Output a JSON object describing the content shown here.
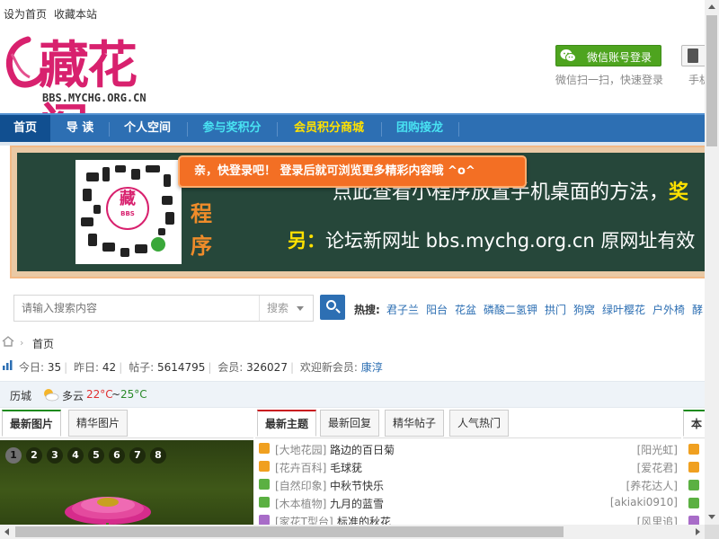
{
  "topbar": {
    "set_home": "设为首页",
    "bookmark": "收藏本站"
  },
  "logo": {
    "text": "藏花阁",
    "url": "BBS.MYCHG.ORG.CN"
  },
  "login": {
    "wechat_button": "微信账号登录",
    "wechat_tip": "微信扫一扫，快速登录",
    "mobile_tip": "手机"
  },
  "nav": {
    "items": [
      "首页",
      "导 读",
      "个人空间",
      "参与奖积分",
      "会员积分商城",
      "团购接龙"
    ]
  },
  "banner": {
    "qr_label": "藏",
    "side_chars": [
      "程",
      "序"
    ],
    "line1_text": "点此查看小程序放置手机桌面的方法，",
    "line1_highlight": "奖",
    "line2_prefix": "另：",
    "line2_text": "论坛新网址 bbs.mychg.org.cn  原网址有效",
    "login_popup": "亲，快登录吧！ 登录后就可浏览更多精彩内容哦 ^o^"
  },
  "search": {
    "placeholder": "请输入搜索内容",
    "type": "搜索",
    "hot_label": "热搜:",
    "hot_words": [
      "君子兰",
      "阳台",
      "花盆",
      "磷酸二氢钾",
      "拱门",
      "狗窝",
      "绿叶樱花",
      "户外椅",
      "酵"
    ]
  },
  "breadcrumb": {
    "home": "首页"
  },
  "stats": {
    "today_label": "今日:",
    "today": "35",
    "yesterday_label": "昨日:",
    "yesterday": "42",
    "posts_label": "帖子:",
    "posts": "5614795",
    "members_label": "会员:",
    "members": "326027",
    "welcome_label": "欢迎新会员:",
    "newest": "康淳"
  },
  "weather": {
    "city": "历城",
    "condition": "多云",
    "high": "22°C",
    "tilde": "~",
    "low": "25°C"
  },
  "left_panel": {
    "tabs": [
      "最新图片",
      "精华图片"
    ],
    "pages": [
      "1",
      "2",
      "3",
      "4",
      "5",
      "6",
      "7",
      "8"
    ]
  },
  "mid_panel": {
    "tabs": [
      "最新主题",
      "最新回复",
      "精华帖子",
      "人气热门"
    ],
    "posts": [
      {
        "forum": "[大地花园]",
        "title": "路边的百日菊",
        "author": "[阳光虹]",
        "color": "#f0a020"
      },
      {
        "forum": "[花卉百科]",
        "title": "毛球莸",
        "author": "[爱花君]",
        "color": "#f0a020"
      },
      {
        "forum": "[自然印象]",
        "title": "中秋节快乐",
        "author": "[养花达人]",
        "color": "#5bb042"
      },
      {
        "forum": "[木本植物]",
        "title": "九月的蓝雪",
        "author": "[akiaki0910]",
        "color": "#5bb042"
      },
      {
        "forum": "[家花T型台]",
        "title": "标准的秋花",
        "author": "[风里追]",
        "color": "#a86cc8"
      }
    ]
  },
  "right_panel": {
    "tab": "本"
  },
  "colors": {
    "nav_blue": "#2d6fb3",
    "brand_pink": "#d8216e",
    "wechat_green": "#4ea41f",
    "popup_orange": "#f36f24"
  }
}
